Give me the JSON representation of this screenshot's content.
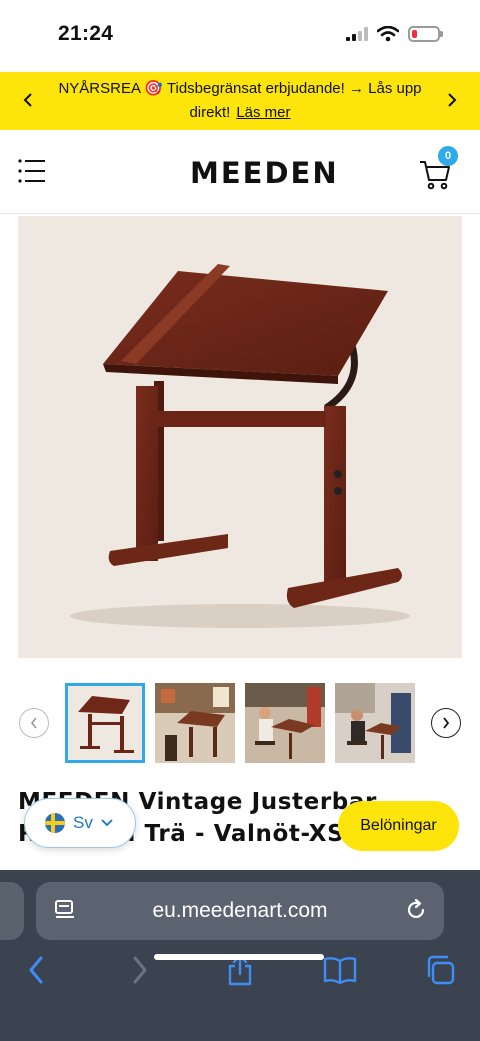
{
  "status": {
    "time": "21:24",
    "battery_level": 0.2,
    "battery_color": "#e8313c"
  },
  "announcement": {
    "text": "NYÅRSREA 🎯 Tidsbegränsat erbjudande! → Lås upp direkt!",
    "link": "Läs mer",
    "background": "#fde40b"
  },
  "header": {
    "logo": "MEEDEN",
    "cart_count": "0",
    "accent": "#2fa9e8"
  },
  "gallery": {
    "main_image": "drafting-table-walnut",
    "thumbnails": [
      {
        "name": "drafting-table-walnut",
        "active": true
      },
      {
        "name": "table-in-room",
        "active": false
      },
      {
        "name": "person-drawing",
        "active": false
      },
      {
        "name": "person-painting",
        "active": false
      }
    ]
  },
  "product": {
    "title": "MEEDEN Vintage Justerbar Ritbord i Trä - Valnöt-XSZ-4"
  },
  "floating": {
    "language": "Sv",
    "rewards": "Belöningar"
  },
  "browser": {
    "url": "eu.meedenart.com"
  }
}
